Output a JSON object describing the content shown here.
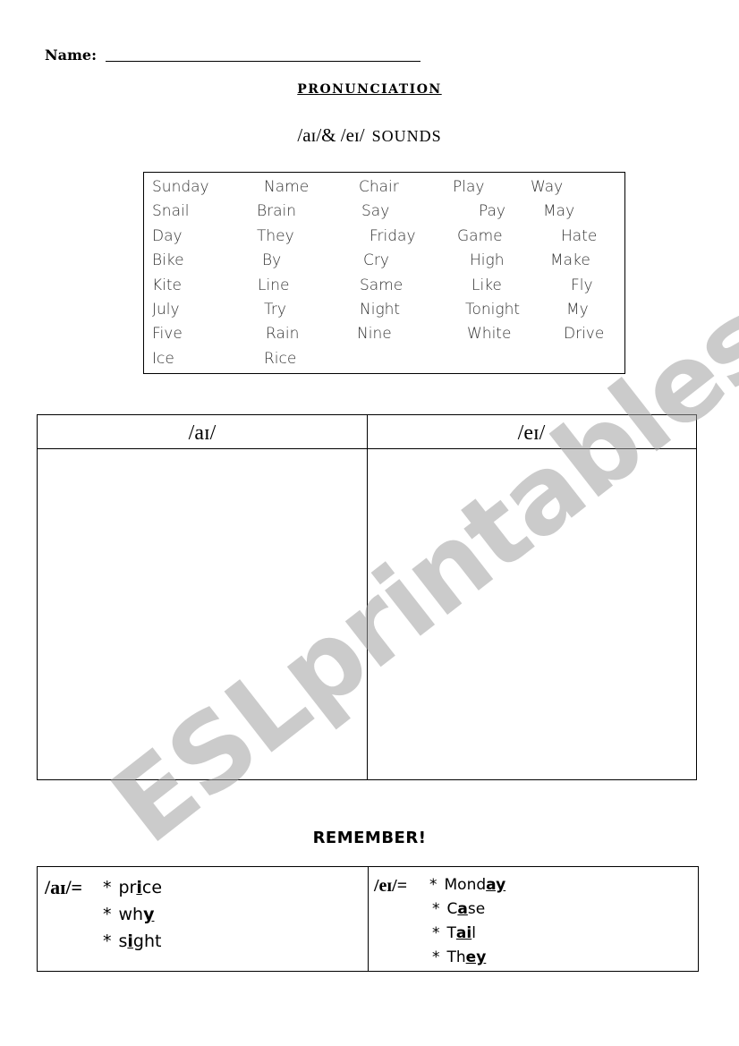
{
  "header": {
    "name_label": "Name:",
    "title": "PRONUNCIATION",
    "subtitle_ipa": "/aɪ/& /eɪ/",
    "subtitle_word": "SOUNDS"
  },
  "word_box": {
    "words": [
      [
        "Sunday",
        "Name",
        "Chair",
        "Play",
        "Way"
      ],
      [
        "Snail",
        "Brain",
        "Say",
        "Pay",
        "May"
      ],
      [
        "Day",
        "They",
        "Friday",
        "Game",
        "Hate"
      ],
      [
        "Bike",
        "By",
        "Cry",
        "High",
        "Make"
      ],
      [
        "Kite",
        "Line",
        "Same",
        "Like",
        "Fly"
      ],
      [
        "July",
        "Try",
        "Night",
        "Tonight",
        "My"
      ],
      [
        "Five",
        "Rain",
        "Nine",
        "White",
        "Drive"
      ],
      [
        "Ice",
        "Rice",
        "",
        "",
        ""
      ]
    ]
  },
  "sort_table": {
    "col1_header": "/aɪ/",
    "col2_header": "/eɪ/"
  },
  "remember": {
    "title": "REMEMBER!",
    "ai": {
      "label": "/aɪ/=",
      "examples": [
        {
          "pre": "pr",
          "u": "i",
          "post": "ce"
        },
        {
          "pre": "wh",
          "u": "y",
          "post": ""
        },
        {
          "pre": "s",
          "u": "i",
          "post": "ght"
        }
      ]
    },
    "ei": {
      "label": "/eɪ/=",
      "examples": [
        {
          "pre": "Mond",
          "u": "ay",
          "post": ""
        },
        {
          "pre": "C",
          "u": "a",
          "post": "se"
        },
        {
          "pre": "T",
          "u": "ai",
          "post": "l"
        },
        {
          "pre": "Th",
          "u": "ey",
          "post": ""
        }
      ]
    },
    "bullet": "*"
  },
  "watermark": "ESLprintables.com"
}
